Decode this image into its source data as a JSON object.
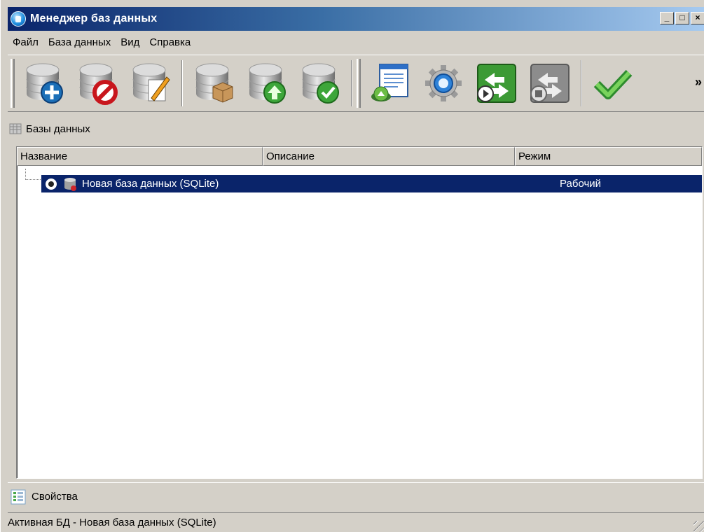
{
  "window": {
    "title": "Менеджер баз данных",
    "controls": {
      "minimize": "_",
      "maximize": "□",
      "close": "×"
    }
  },
  "menu": [
    {
      "label": "Файл"
    },
    {
      "label": "База данных"
    },
    {
      "label": "Вид"
    },
    {
      "label": "Справка"
    }
  ],
  "toolbar": {
    "buttons": [
      {
        "icon": "db-add-icon"
      },
      {
        "icon": "db-remove-icon"
      },
      {
        "icon": "db-edit-icon"
      },
      {
        "icon": "db-archive-icon"
      },
      {
        "icon": "db-upload-icon"
      },
      {
        "icon": "db-check-icon"
      },
      {
        "icon": "window-open-icon"
      },
      {
        "icon": "settings-gear-icon"
      },
      {
        "icon": "connect-icon"
      },
      {
        "icon": "disconnect-icon"
      },
      {
        "icon": "apply-check-icon"
      }
    ],
    "overflow": "»"
  },
  "databases_panel": {
    "title": "Базы данных",
    "columns": [
      "Название",
      "Описание",
      "Режим"
    ],
    "rows": [
      {
        "name": "Новая база данных (SQLite)",
        "description": "",
        "mode": "Рабочий",
        "selected": true
      }
    ]
  },
  "properties_panel": {
    "title": "Свойства"
  },
  "status": {
    "text": "Активная БД - Новая база данных (SQLite)"
  },
  "colors": {
    "selection": "#0a246a",
    "title_start": "#0a246a",
    "title_end": "#a6caf0",
    "chrome": "#d4d0c8"
  }
}
